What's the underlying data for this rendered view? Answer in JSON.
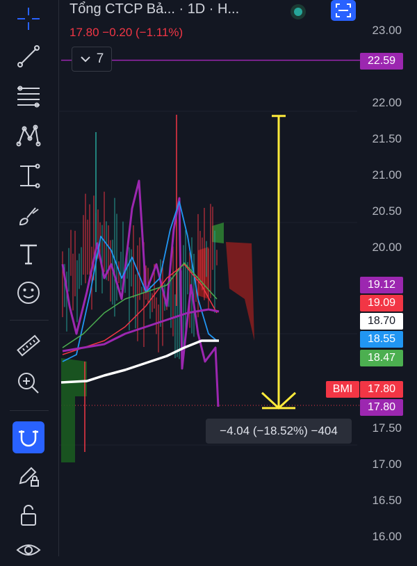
{
  "header": {
    "title": "Tổng CTCP Bả... · 1D · H...",
    "price_change": "17.80  −0.20 (−1.11%)",
    "indicators_count": "7"
  },
  "axis": {
    "price_labels": [
      "23.00",
      "22.00",
      "21.50",
      "21.00",
      "20.50",
      "20.00",
      "17.50",
      "17.00",
      "16.50",
      "16.00"
    ]
  },
  "price_tags": [
    {
      "value": "22.59",
      "bg": "#9c27b0",
      "fg": "#ffffff"
    },
    {
      "value": "19.12",
      "bg": "#9c27b0",
      "fg": "#ffffff"
    },
    {
      "value": "19.09",
      "bg": "#f23645",
      "fg": "#ffffff"
    },
    {
      "value": "18.70",
      "bg": "#ffffff",
      "fg": "#131722"
    },
    {
      "value": "18.55",
      "bg": "#2196f3",
      "fg": "#ffffff"
    },
    {
      "value": "18.47",
      "bg": "#4caf50",
      "fg": "#ffffff"
    },
    {
      "value": "17.80",
      "bg": "#f23645",
      "fg": "#ffffff"
    },
    {
      "value": "17.80",
      "bg": "#9c27b0",
      "fg": "#ffffff"
    }
  ],
  "ticker_badge": "BMI",
  "measure": {
    "label": "−4.04 (−18.52%) −404",
    "from_price": 21.82,
    "to_price": 17.78,
    "color": "#ffeb3b"
  },
  "horizontal_line_price": 22.59,
  "colors": {
    "accent": "#2962ff",
    "up": "#26a69a",
    "down": "#f23645",
    "purple": "#9c27b0"
  },
  "toolbar": {
    "tools": [
      {
        "name": "crosshair-icon"
      },
      {
        "name": "trend-line-icon"
      },
      {
        "name": "fib-retracement-icon"
      },
      {
        "name": "pattern-icon"
      },
      {
        "name": "measure-price-icon"
      },
      {
        "name": "brush-icon"
      },
      {
        "name": "text-icon"
      },
      {
        "name": "emoji-icon"
      },
      {
        "name": "ruler-icon"
      },
      {
        "name": "zoom-in-icon"
      },
      {
        "name": "magnet-icon"
      },
      {
        "name": "edit-lock-icon"
      },
      {
        "name": "unlock-icon"
      },
      {
        "name": "eye-icon"
      }
    ]
  }
}
